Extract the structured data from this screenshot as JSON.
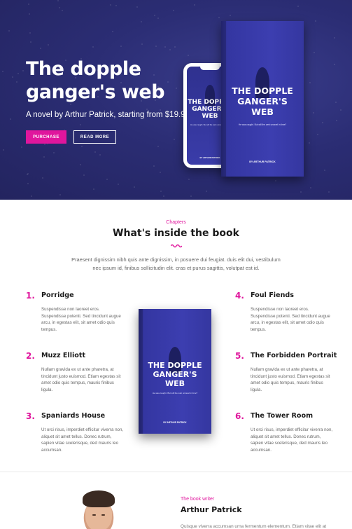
{
  "hero": {
    "title": "The dopple ganger's web",
    "subtitle": "A novel by Arthur Patrick, starting from $19.99",
    "purchase_label": "PURCHASE",
    "read_more_label": "READ MORE"
  },
  "book_cover": {
    "title": "THE DOPPLE GANGER'S WEB",
    "tagline": "He was caught. But will the web unravel in time?",
    "author": "BY ARTHUR PATRICK"
  },
  "chapters_section": {
    "kicker": "Chapters",
    "title": "What's inside the book",
    "intro": "Praesent dignissim nibh quis ante dignissim, in posuere dui feugiat. duis elit dui, vestibulum nec ipsum id, finibus sollicitudin elit. cras et purus sagittis, volutpat est id.",
    "chapters": [
      {
        "num": "1.",
        "title": "Porridge",
        "desc": "Suspendisse non laoreet eros. Suspendisse potenti. Sed tincidunt augue arcu, in egestas elit, sit amet odio quis tempus."
      },
      {
        "num": "2.",
        "title": "Muzz Elliott",
        "desc": "Nullam gravida ex ut ante pharetra, at tincidunt justo euismod. Etiam egestas sit amet odio quis tempus, mauris finibus ligula."
      },
      {
        "num": "3.",
        "title": "Spaniards House",
        "desc": "Ut orci risus, imperdiet efficitur viverra non, aliquet sit amet tellus. Donec rutrum, sapien vitae scelerisque, ded mauris leo accumsan."
      },
      {
        "num": "4.",
        "title": "Foul Fiends",
        "desc": "Suspendisse non laoreet eros. Suspendisse potenti. Sed tincidunt augue arcu, in egestas elit, sit amet odio quis tempus."
      },
      {
        "num": "5.",
        "title": "The Forbidden Portrait",
        "desc": "Nullam gravida ex ut ante pharetra, at tincidunt justo euismod. Etiam egestas sit amet odio quis tempus, mauris finibus ligula."
      },
      {
        "num": "6.",
        "title": "The Tower Room",
        "desc": "Ut orci risus, imperdiet efficitur viverra non, aliquet sit amet tellus. Donec rutrum, sapien vitae scelerisque, ded mauris leo accumsan."
      }
    ]
  },
  "writer": {
    "kicker": "The book writer",
    "name": "Arthur Patrick",
    "bio": "Quisque viverra accumsan urna fermentum elementum. Etiam vitae elit at"
  },
  "colors": {
    "accent": "#e0169d",
    "hero_bg": "#2b2d74",
    "book_blue": "#3a3cab"
  }
}
